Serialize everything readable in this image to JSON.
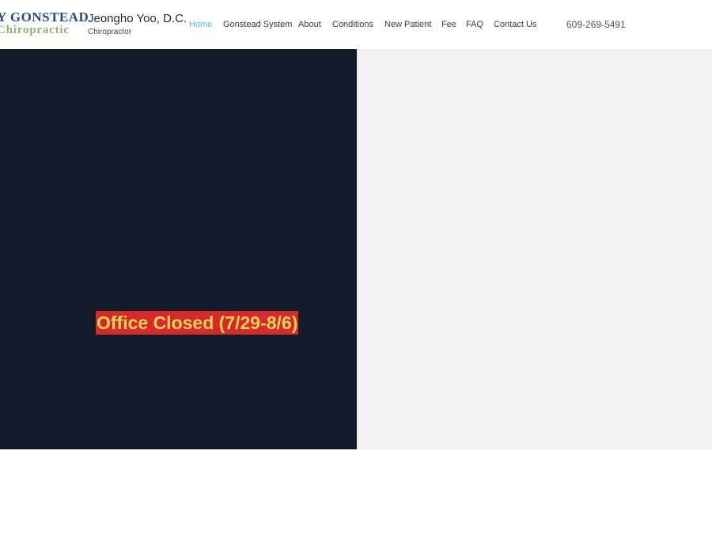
{
  "logo": {
    "line1": "Y GONSTEAD",
    "line2": "Chiropractic",
    "colors": {
      "primary": "#2a4d7a",
      "secondary": "#8fb07a"
    }
  },
  "doctor": {
    "name": "Jeongho Yoo, D.C.",
    "title": "Chiropractor"
  },
  "nav": {
    "items": [
      {
        "label": "Home",
        "active": true
      },
      {
        "label": "Gonstead System",
        "active": false
      },
      {
        "label": "About",
        "active": false
      },
      {
        "label": "Conditions",
        "active": false
      },
      {
        "label": "New Patient",
        "active": false
      },
      {
        "label": "Fee",
        "active": false
      },
      {
        "label": "FAQ",
        "active": false
      },
      {
        "label": "Contact Us",
        "active": false
      }
    ],
    "active_color": "#5bbccb"
  },
  "phone": "609-269-5491",
  "hero": {
    "banner_text": "Office Closed (7/29-8/6)",
    "colors": {
      "left_panel": "#121c2b",
      "right_panel": "#f1f1f1",
      "banner_bg": "#d52a2a",
      "banner_text": "#e6d25a"
    }
  }
}
